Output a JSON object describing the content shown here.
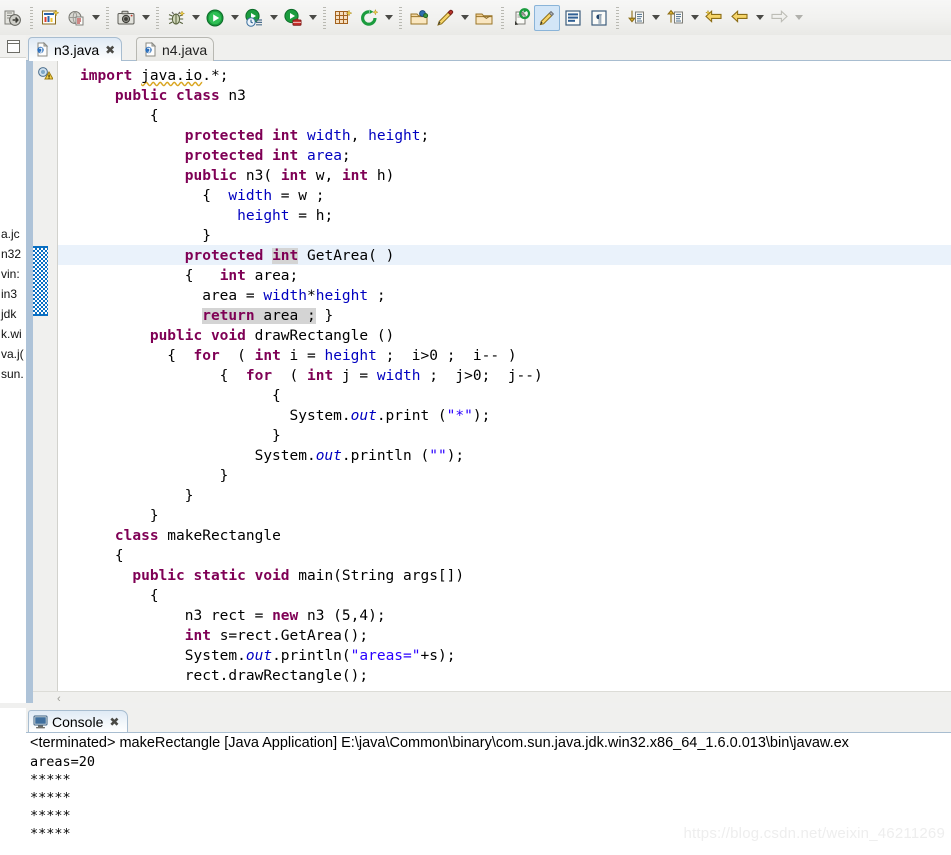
{
  "toolbar": {
    "groups": [
      {
        "items": [
          {
            "name": "open-type-icon",
            "kind": "icon-open-type"
          }
        ]
      },
      {
        "items": [
          {
            "name": "new-java-project-icon",
            "kind": "icon-new-wizard"
          },
          {
            "name": "new-package-icon",
            "kind": "icon-globe-doc"
          },
          {
            "name": "new-dropdown-arrow",
            "kind": "arrow"
          }
        ]
      },
      {
        "items": [
          {
            "name": "screenshot-icon",
            "kind": "icon-camera"
          },
          {
            "name": "screenshot-dropdown-arrow",
            "kind": "arrow"
          }
        ]
      },
      {
        "items": [
          {
            "name": "debug-icon",
            "kind": "icon-bug"
          },
          {
            "name": "debug-dropdown-arrow",
            "kind": "arrow"
          },
          {
            "name": "run-icon",
            "kind": "icon-run"
          },
          {
            "name": "run-dropdown-arrow",
            "kind": "arrow"
          },
          {
            "name": "run-history-icon",
            "kind": "icon-run-history"
          },
          {
            "name": "run-history-dropdown-arrow",
            "kind": "arrow"
          },
          {
            "name": "external-tools-icon",
            "kind": "icon-run-tools"
          },
          {
            "name": "external-tools-dropdown-arrow",
            "kind": "arrow"
          }
        ]
      },
      {
        "items": [
          {
            "name": "new-java-class-icon",
            "kind": "icon-grid-new"
          },
          {
            "name": "coverage-icon",
            "kind": "icon-coverage"
          },
          {
            "name": "coverage-dropdown-arrow",
            "kind": "arrow"
          }
        ]
      },
      {
        "items": [
          {
            "name": "open-resource-icon",
            "kind": "icon-folder-blue"
          },
          {
            "name": "pencil-icon",
            "kind": "icon-pencil"
          },
          {
            "name": "pencil-dropdown-arrow",
            "kind": "arrow"
          },
          {
            "name": "open-folder-icon",
            "kind": "icon-folder-tan"
          }
        ]
      },
      {
        "items": [
          {
            "name": "search-refresh-icon",
            "kind": "icon-search-refresh"
          },
          {
            "name": "toggle-mark-occurrences-icon",
            "kind": "icon-marker-pen",
            "active": true
          },
          {
            "name": "toggle-block-selection-icon",
            "kind": "icon-block-select"
          },
          {
            "name": "show-whitespace-icon",
            "kind": "icon-pilcrow"
          }
        ]
      },
      {
        "items": [
          {
            "name": "next-annotation-icon",
            "kind": "icon-next-annotation"
          },
          {
            "name": "next-annotation-dropdown-arrow",
            "kind": "arrow"
          },
          {
            "name": "previous-annotation-icon",
            "kind": "icon-prev-annotation"
          },
          {
            "name": "previous-annotation-dropdown-arrow",
            "kind": "arrow"
          },
          {
            "name": "last-edit-location-icon",
            "kind": "icon-last-edit"
          },
          {
            "name": "back-icon",
            "kind": "icon-back"
          },
          {
            "name": "back-dropdown-arrow",
            "kind": "arrow"
          },
          {
            "name": "forward-icon",
            "kind": "icon-forward-disabled"
          },
          {
            "name": "forward-dropdown-arrow",
            "kind": "arrow-dim"
          }
        ]
      }
    ]
  },
  "left_panel": {
    "truncated_lines": [
      "a.jc",
      "n32",
      "vin:",
      "in3",
      "jdk",
      "k.wi",
      "va.j(",
      "sun."
    ]
  },
  "editor": {
    "tabs": [
      {
        "label": "n3.java",
        "active": true,
        "close": "✖"
      },
      {
        "label": "n4.java",
        "active": false
      }
    ],
    "scroll_chevron": "‹",
    "code_lines": [
      {
        "indent": 0,
        "tokens": [
          {
            "t": "import",
            "c": "kw"
          },
          {
            "t": " "
          },
          {
            "t": "java.io",
            "c": "sq"
          },
          {
            "t": ".*;"
          }
        ]
      },
      {
        "indent": 2,
        "tokens": [
          {
            "t": "public class",
            "c": "kw"
          },
          {
            "t": " n3"
          }
        ]
      },
      {
        "indent": 4,
        "tokens": [
          {
            "t": "{"
          }
        ]
      },
      {
        "indent": 6,
        "tokens": [
          {
            "t": "protected int",
            "c": "kw"
          },
          {
            "t": " "
          },
          {
            "t": "width",
            "c": "fld"
          },
          {
            "t": ", "
          },
          {
            "t": "height",
            "c": "fld"
          },
          {
            "t": ";"
          }
        ]
      },
      {
        "indent": 6,
        "tokens": [
          {
            "t": "protected int",
            "c": "kw"
          },
          {
            "t": " "
          },
          {
            "t": "area",
            "c": "fld"
          },
          {
            "t": ";"
          }
        ]
      },
      {
        "indent": 6,
        "tokens": [
          {
            "t": "public",
            "c": "kw"
          },
          {
            "t": " n3( "
          },
          {
            "t": "int",
            "c": "kw"
          },
          {
            "t": " w, "
          },
          {
            "t": "int",
            "c": "kw"
          },
          {
            "t": " h)"
          }
        ]
      },
      {
        "indent": 7,
        "tokens": [
          {
            "t": "{  "
          },
          {
            "t": "width",
            "c": "fld"
          },
          {
            "t": " = w ;"
          }
        ]
      },
      {
        "indent": 9,
        "tokens": [
          {
            "t": "height",
            "c": "fld"
          },
          {
            "t": " = h;"
          }
        ]
      },
      {
        "indent": 7,
        "tokens": [
          {
            "t": "}"
          }
        ]
      },
      {
        "indent": 6,
        "highlight": true,
        "tokens": [
          {
            "t": "protected",
            "c": "kw"
          },
          {
            "t": " "
          },
          {
            "t": "int",
            "c": "kw occ"
          },
          {
            "t": " GetArea( )"
          }
        ]
      },
      {
        "indent": 6,
        "tokens": [
          {
            "t": "{   "
          },
          {
            "t": "int",
            "c": "kw"
          },
          {
            "t": " area;"
          }
        ]
      },
      {
        "indent": 7,
        "tokens": [
          {
            "t": "area = "
          },
          {
            "t": "width",
            "c": "fld"
          },
          {
            "t": "*"
          },
          {
            "t": "height",
            "c": "fld"
          },
          {
            "t": " ;"
          }
        ]
      },
      {
        "indent": 7,
        "tokens": [
          {
            "t": "return",
            "c": "kw occ"
          },
          {
            "t": " area ;",
            "c": "occ"
          },
          {
            "t": " }"
          }
        ]
      },
      {
        "indent": 4,
        "tokens": [
          {
            "t": "public void",
            "c": "kw"
          },
          {
            "t": " drawRectangle ()"
          }
        ]
      },
      {
        "indent": 5,
        "tokens": [
          {
            "t": "{  "
          },
          {
            "t": "for",
            "c": "kw"
          },
          {
            "t": "  ( "
          },
          {
            "t": "int",
            "c": "kw"
          },
          {
            "t": " i = "
          },
          {
            "t": "height",
            "c": "fld"
          },
          {
            "t": " ;  i>0 ;  i-- )"
          }
        ]
      },
      {
        "indent": 8,
        "tokens": [
          {
            "t": "{  "
          },
          {
            "t": "for",
            "c": "kw"
          },
          {
            "t": "  ( "
          },
          {
            "t": "int",
            "c": "kw"
          },
          {
            "t": " j = "
          },
          {
            "t": "width",
            "c": "fld"
          },
          {
            "t": " ;  j>0;  j--)"
          }
        ]
      },
      {
        "indent": 11,
        "tokens": [
          {
            "t": "{"
          }
        ]
      },
      {
        "indent": 12,
        "tokens": [
          {
            "t": "System."
          },
          {
            "t": "out",
            "c": "sfld"
          },
          {
            "t": ".print ("
          },
          {
            "t": "\"*\"",
            "c": "str"
          },
          {
            "t": ");"
          }
        ]
      },
      {
        "indent": 11,
        "tokens": [
          {
            "t": "}"
          }
        ]
      },
      {
        "indent": 10,
        "tokens": [
          {
            "t": "System."
          },
          {
            "t": "out",
            "c": "sfld"
          },
          {
            "t": ".println ("
          },
          {
            "t": "\"\"",
            "c": "str"
          },
          {
            "t": ");"
          }
        ]
      },
      {
        "indent": 8,
        "tokens": [
          {
            "t": "}"
          }
        ]
      },
      {
        "indent": 6,
        "tokens": [
          {
            "t": "}"
          }
        ]
      },
      {
        "indent": 4,
        "tokens": [
          {
            "t": "}"
          }
        ]
      },
      {
        "indent": 2,
        "tokens": [
          {
            "t": "class",
            "c": "kw"
          },
          {
            "t": " makeRectangle"
          }
        ]
      },
      {
        "indent": 2,
        "tokens": [
          {
            "t": "{"
          }
        ]
      },
      {
        "indent": 3,
        "tokens": [
          {
            "t": "public static void",
            "c": "kw"
          },
          {
            "t": " main(String args[])"
          }
        ]
      },
      {
        "indent": 4,
        "tokens": [
          {
            "t": "{"
          }
        ]
      },
      {
        "indent": 6,
        "tokens": [
          {
            "t": "n3 rect = "
          },
          {
            "t": "new",
            "c": "kw"
          },
          {
            "t": " n3 (5,4);"
          }
        ]
      },
      {
        "indent": 6,
        "tokens": [
          {
            "t": "int",
            "c": "kw"
          },
          {
            "t": " s=rect.GetArea();"
          }
        ]
      },
      {
        "indent": 6,
        "tokens": [
          {
            "t": "System."
          },
          {
            "t": "out",
            "c": "sfld"
          },
          {
            "t": ".println("
          },
          {
            "t": "\"areas=\"",
            "c": "str"
          },
          {
            "t": "+s);"
          }
        ]
      },
      {
        "indent": 6,
        "tokens": [
          {
            "t": "rect.drawRectangle();"
          }
        ]
      }
    ]
  },
  "console": {
    "tab_label": "Console",
    "tab_close": "✖",
    "title": "<terminated> makeRectangle [Java Application] E:\\java\\Common\\binary\\com.sun.java.jdk.win32.x86_64_1.6.0.013\\bin\\javaw.ex",
    "output": "areas=20\n*****\n*****\n*****\n*****"
  },
  "watermark": "https://blog.csdn.net/weixin_46211269",
  "colors": {
    "keyword": "#7f0055",
    "field": "#0000c0",
    "string": "#2a00ff",
    "occurrence_highlight": "#d4d4d4",
    "current_line": "#eaf2fb",
    "tab_border": "#a8bdd0",
    "sash": "#aec3d8",
    "selection_marker": "#0a6fc2"
  }
}
